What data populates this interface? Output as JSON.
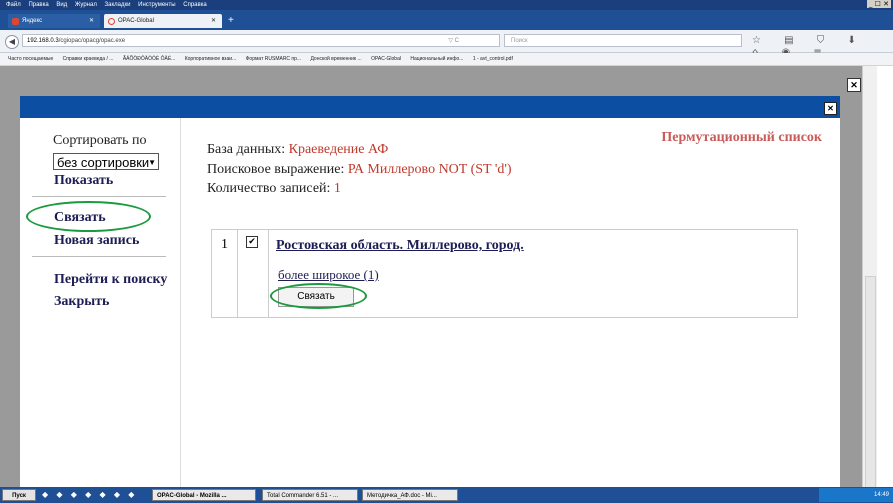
{
  "browser": {
    "menu": [
      "Файл",
      "Правка",
      "Вид",
      "Журнал",
      "Закладки",
      "Инструменты",
      "Справка"
    ],
    "window_controls": "_ ☐ ✕",
    "tabs": [
      {
        "label": "Яндекс",
        "close": "✕"
      },
      {
        "label": "OPAC-Global",
        "close": "✕"
      }
    ],
    "new_tab": "+",
    "back": "◀",
    "url_host": "192.168.0.3",
    "url_path": "/cgiopac/opacg/opac.exe",
    "reload": "▽ C",
    "search_placeholder": "Поиск",
    "toolbar_icons": "☆ ▤ ⛉ ⬇ ⌂ ◉ ≡",
    "bookmarks": [
      "Часто посещаемые",
      "Справки краеведа / ...",
      "ÃÄÕÖÐÔÄÖÖÈ ÔÄÉ...",
      "Корпоративное взаи...",
      "Формат RUSMARC пр...",
      "Донской временник ...",
      "OPAC-Global",
      "Национальный инфо...",
      "1 - avt_control.pdf"
    ]
  },
  "background_letters": [
    "С",
    "С",
    "Ф",
    "Е",
    "П",
    "Н",
    "В",
    "Н",
    "С"
  ],
  "outer_close": "✕",
  "dialog": {
    "close": "✕",
    "sidebar": {
      "sort_label": "Сортировать по",
      "sort_value": "без сортировки",
      "show": "Показать",
      "link": "Связать",
      "new_record": "Новая запись",
      "go_search": "Перейти к поиску",
      "close": "Закрыть"
    },
    "title": "Пермутационный список",
    "db_label": "База данных:",
    "db_value": "Краеведение АФ",
    "query_label": "Поисковое выражение:",
    "query_value": "РА Миллерово NOT (ST 'd')",
    "count_label": "Количество записей:",
    "count_value": "1",
    "record": {
      "number": "1",
      "checked": "✔",
      "title": "Ростовская область. Миллерово, город.",
      "broader": "более широкое (1)",
      "button": "Связать"
    }
  },
  "taskbar": {
    "start": "Пуск",
    "quick_launch": "◆ ◆ ◆ ◆ ◆ ◆ ◆",
    "tasks": [
      "OPAC-Global - Mozilla ...",
      "Total Commander 6.51 - ...",
      "Методичка_АФ.doc - Mi..."
    ],
    "clock": "14:49"
  },
  "colors": {
    "dialog_title_bar": "#0b4ea2",
    "value_red": "#c0392b",
    "highlight_green": "#1a9a3e"
  }
}
